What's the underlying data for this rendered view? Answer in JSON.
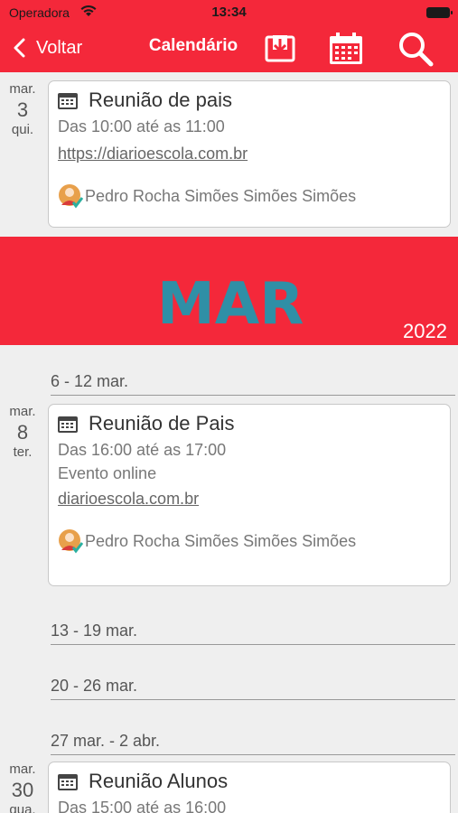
{
  "status_bar": {
    "carrier": "Operadora",
    "time": "13:34"
  },
  "nav": {
    "back_label": "Voltar",
    "title": "Calendário"
  },
  "colors": {
    "brand": "#f4283a",
    "background": "#efefef"
  },
  "events": [
    {
      "month": "mar.",
      "day": "3",
      "weekday": "qui.",
      "title": "Reunião de pais",
      "time": "Das 10:00 até as 11:00",
      "link": "https://diarioescola.com.br",
      "author": "Pedro Rocha Simões Simões Simões"
    },
    {
      "month": "mar.",
      "day": "8",
      "weekday": "ter.",
      "title": "Reunião de Pais",
      "time": "Das 16:00 até as 17:00",
      "location": "Evento online",
      "link": "diarioescola.com.br",
      "author": "Pedro Rocha Simões Simões Simões"
    },
    {
      "month": "mar.",
      "day": "30",
      "weekday": "qua.",
      "title": "Reunião Alunos",
      "time": "Das 15:00 até as 16:00"
    }
  ],
  "month_banner": {
    "art_text": "MAR",
    "year": "2022"
  },
  "weeks": [
    "6 - 12 mar.",
    "13 - 19 mar.",
    "20 - 26 mar.",
    "27 mar. - 2 abr."
  ],
  "icons": {
    "back": "chevron-left-icon",
    "export": "download-tray-icon",
    "calendar": "calendar-icon",
    "search": "search-icon",
    "event": "calendar-small-icon",
    "author": "teacher-avatar-icon"
  }
}
